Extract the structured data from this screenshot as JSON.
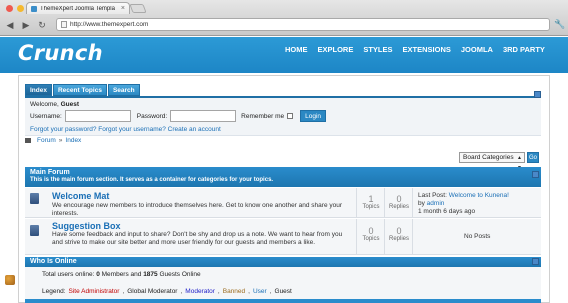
{
  "browser": {
    "tab_title": "ThemeXpert Joomla Templa",
    "url": "http://www.themexpert.com",
    "dot_colors": [
      "#ef5a50",
      "#f5b92e",
      "#5fc53c"
    ]
  },
  "site": {
    "logo": "Crunch",
    "menu": [
      "HOME",
      "EXPLORE",
      "STYLES",
      "EXTENSIONS",
      "JOOMLA",
      "3RD PARTY"
    ]
  },
  "forum_tabs": [
    "Index",
    "Recent Topics",
    "Search"
  ],
  "login": {
    "welcome_prefix": "Welcome, ",
    "welcome_name": "Guest",
    "username_label": "Username:",
    "password_label": "Password:",
    "remember_label": "Remember me",
    "login_button": "Login",
    "forgot_password": "Forgot your password?",
    "forgot_username": "Forgot your username?",
    "create_account": "Create an account"
  },
  "breadcrumb": {
    "forum": "Forum",
    "sep": "»",
    "index": "Index"
  },
  "category_select": {
    "value": "Board Categories",
    "go": "Go"
  },
  "main_forum": {
    "title": "Main Forum",
    "description": "This is the main forum section. It serves as a container for categories for your topics.",
    "forums": [
      {
        "name": "Welcome Mat",
        "description": "We encourage new members to introduce themselves here. Get to know one another and share your interests.",
        "topics": "1",
        "topics_label": "Topics",
        "replies": "0",
        "replies_label": "Replies",
        "last_post_label": "Last Post: ",
        "last_post_title": "Welcome to Kunena!",
        "by_label": "by ",
        "last_post_author": "admin",
        "last_post_time": "1 month 6 days ago"
      },
      {
        "name": "Suggestion Box",
        "description": "Have some feedback and input to share? Don't be shy and drop us a note. We want to hear from you and strive to make our site better and more user friendly for our guests and members a like.",
        "topics": "0",
        "topics_label": "Topics",
        "replies": "0",
        "replies_label": "Replies",
        "no_posts": "No Posts"
      }
    ]
  },
  "who_online": {
    "title": "Who Is Online",
    "total_prefix": "Total users online: ",
    "members_count": "0",
    "members_label": " Members and ",
    "guests_count": "1875",
    "guests_label": " Guests Online",
    "legend_label": "Legend:",
    "legend": [
      {
        "name": "Site Administrator",
        "color": "#c00000"
      },
      {
        "name": "Global Moderator",
        "color": "#222222"
      },
      {
        "name": "Moderator",
        "color": "#1e1ec8"
      },
      {
        "name": "Banned",
        "color": "#9a6b1e"
      },
      {
        "name": "User",
        "color": "#1a6fb6"
      },
      {
        "name": "Guest",
        "color": "#222222"
      }
    ]
  }
}
